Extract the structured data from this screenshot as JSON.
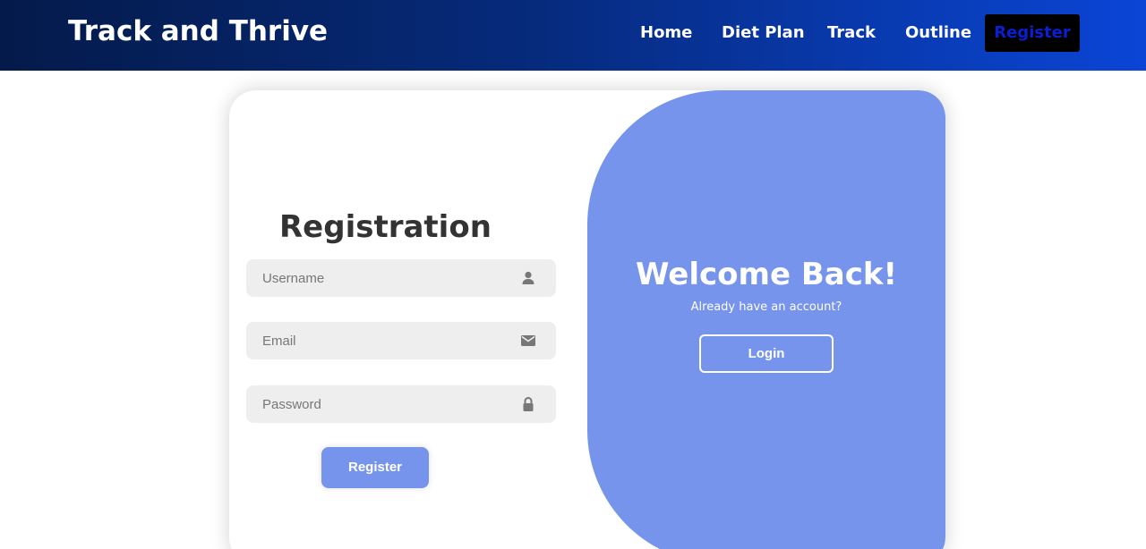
{
  "header": {
    "brand": "Track and Thrive",
    "nav": {
      "home": "Home",
      "diet_plan": "Diet Plan",
      "track": "Track",
      "outline": "Outline",
      "register": "Register"
    }
  },
  "form": {
    "title": "Registration",
    "username_placeholder": "Username",
    "email_placeholder": "Email",
    "password_placeholder": "Password",
    "submit_label": "Register",
    "username_icon": "user-icon",
    "email_icon": "envelope-icon",
    "password_icon": "lock-icon"
  },
  "welcome": {
    "title": "Welcome Back!",
    "subtitle": "Already have an account?",
    "login_label": "Login"
  },
  "colors": {
    "accent": "#7694eb",
    "nav_dark": "#041a4a",
    "nav_light": "#0a45d6"
  }
}
